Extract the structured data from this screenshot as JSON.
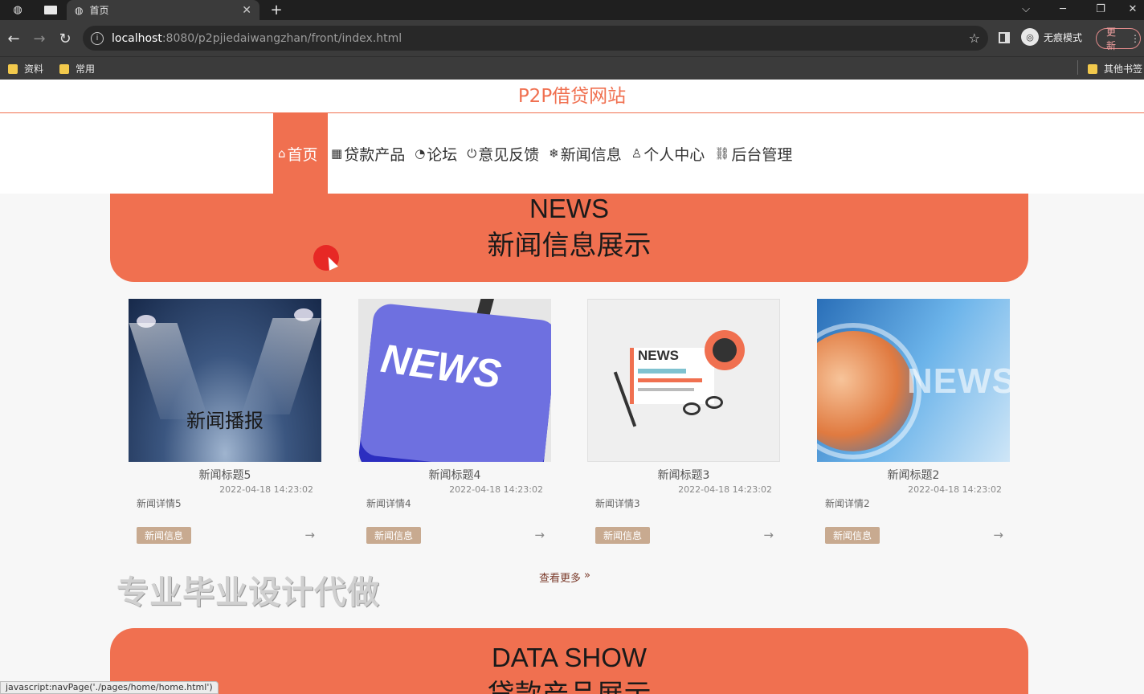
{
  "browser": {
    "tab_title": "首页",
    "url_host": "localhost",
    "url_rest": ":8080/p2pjiedaiwangzhan/front/index.html",
    "incognito_label": "无痕模式",
    "update_label": "更新",
    "bookmarks": [
      "资料",
      "常用"
    ],
    "other_bookmarks": "其他书签",
    "status_url": "javascript:navPage('./pages/home/home.html')"
  },
  "site": {
    "title": "P2P借贷网站",
    "nav": [
      {
        "icon": "⌂",
        "label": "首页"
      },
      {
        "icon": "▦",
        "label": "贷款产品"
      },
      {
        "icon": "◔",
        "label": "论坛"
      },
      {
        "icon": "⏻",
        "label": "意见反馈"
      },
      {
        "icon": "❄",
        "label": "新闻信息"
      },
      {
        "icon": "♙",
        "label": "个人中心"
      },
      {
        "icon": "⛓",
        "label": "后台管理"
      }
    ]
  },
  "news_section": {
    "title_en": "NEWS",
    "title_cn": "新闻信息展示",
    "cards": [
      {
        "image_text": "新闻播报",
        "title": "新闻标题5",
        "date": "2022-04-18 14:23:02",
        "detail": "新闻详情5",
        "tag": "新闻信息"
      },
      {
        "image_text": "NEWS",
        "title": "新闻标题4",
        "date": "2022-04-18 14:23:02",
        "detail": "新闻详情4",
        "tag": "新闻信息"
      },
      {
        "image_text": "NEWS",
        "title": "新闻标题3",
        "date": "2022-04-18 14:23:02",
        "detail": "新闻详情3",
        "tag": "新闻信息"
      },
      {
        "image_text": "NEWS",
        "title": "新闻标题2",
        "date": "2022-04-18 14:23:02",
        "detail": "新闻详情2",
        "tag": "新闻信息"
      }
    ],
    "more_label": "查看更多",
    "more_icon": "»"
  },
  "watermark": "专业毕业设计代做",
  "data_section": {
    "title_en": "DATA SHOW",
    "title_cn": "贷款产品展示"
  },
  "colors": {
    "accent": "#f07050",
    "tag": "#c8aa90"
  }
}
